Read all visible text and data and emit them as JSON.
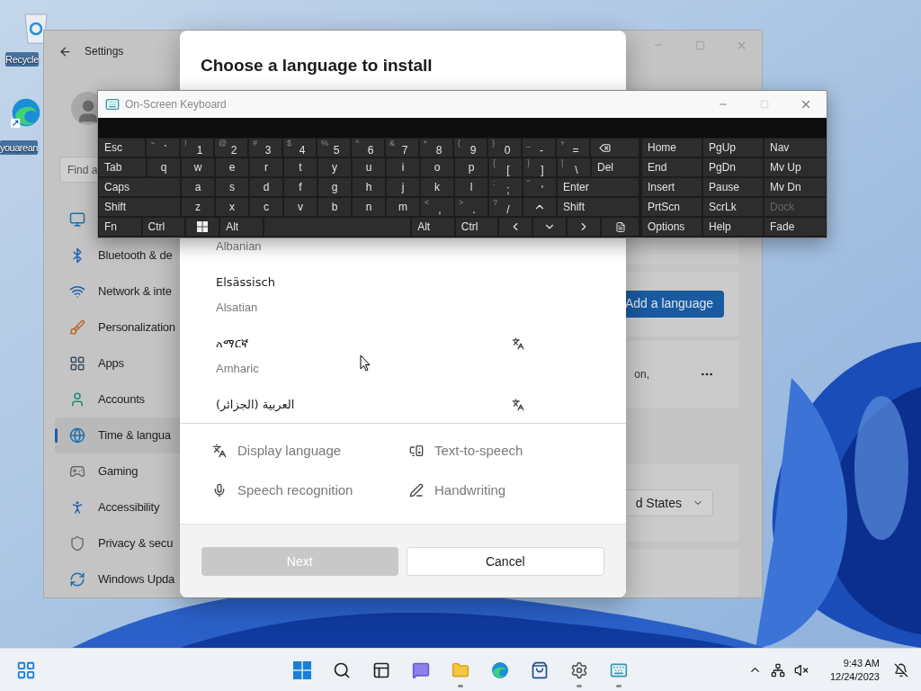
{
  "desktop": {
    "icons": [
      {
        "label": "Recycle"
      },
      {
        "label": "youarean"
      }
    ]
  },
  "settings": {
    "title": "Settings",
    "search": {
      "placeholder": "Find a"
    },
    "sidebar": {
      "items": [
        {
          "selected": false
        },
        {
          "label": "Bluetooth & de",
          "selected": false
        },
        {
          "label": "Network & inte",
          "selected": false
        },
        {
          "label": "Personalization",
          "selected": false
        },
        {
          "label": "Apps",
          "selected": false
        },
        {
          "label": "Accounts",
          "selected": false
        },
        {
          "label": "Time & langua",
          "selected": true
        },
        {
          "label": "Gaming",
          "selected": false
        },
        {
          "label": "Accessibility",
          "selected": false
        },
        {
          "label": "Privacy & secu",
          "selected": false
        },
        {
          "label": "Windows Upda",
          "selected": false
        }
      ]
    },
    "content": {
      "add_button": "Add a language",
      "card_text": "on,",
      "region_value": "d States"
    }
  },
  "dialog": {
    "title": "Choose a language to install",
    "languages": [
      {
        "english": "Albanian",
        "display_language": false
      },
      {
        "native": "Elsässisch",
        "english": "Alsatian",
        "display_language": false
      },
      {
        "native": "አማርኛ",
        "english": "Amharic",
        "display_language": true
      },
      {
        "native": "العربية (الجزائر)",
        "display_language": true
      }
    ],
    "features": [
      {
        "label": "Display language"
      },
      {
        "label": "Text-to-speech"
      },
      {
        "label": "Speech recognition"
      },
      {
        "label": "Handwriting"
      }
    ],
    "buttons": [
      {
        "label": "Next",
        "disabled": true
      },
      {
        "label": "Cancel",
        "disabled": false
      }
    ]
  },
  "keyboard": {
    "title": "On-Screen Keyboard",
    "rows": [
      {
        "keys": [
          {
            "kind": "label",
            "label": "Esc"
          },
          {
            "kind": "char",
            "shift": "~",
            "main": "`"
          },
          {
            "kind": "char",
            "shift": "!",
            "main": "1"
          },
          {
            "kind": "char",
            "shift": "@",
            "main": "2"
          },
          {
            "kind": "char",
            "shift": "#",
            "main": "3"
          },
          {
            "kind": "char",
            "shift": "$",
            "main": "4"
          },
          {
            "kind": "char",
            "shift": "%",
            "main": "5"
          },
          {
            "kind": "char",
            "shift": "^",
            "main": "6"
          },
          {
            "kind": "char",
            "shift": "&",
            "main": "7"
          },
          {
            "kind": "char",
            "shift": "*",
            "main": "8"
          },
          {
            "kind": "char",
            "shift": "(",
            "main": "9"
          },
          {
            "kind": "char",
            "shift": ")",
            "main": "0"
          },
          {
            "kind": "char",
            "shift": "_",
            "main": "-"
          },
          {
            "kind": "char",
            "shift": "+",
            "main": "="
          },
          {
            "kind": "backspace"
          }
        ]
      },
      {
        "keys": [
          {
            "kind": "label",
            "label": "Tab"
          },
          {
            "kind": "char",
            "main": "q"
          },
          {
            "kind": "char",
            "main": "w"
          },
          {
            "kind": "char",
            "main": "e"
          },
          {
            "kind": "char",
            "main": "r"
          },
          {
            "kind": "char",
            "main": "t"
          },
          {
            "kind": "char",
            "main": "y"
          },
          {
            "kind": "char",
            "main": "u"
          },
          {
            "kind": "char",
            "main": "i"
          },
          {
            "kind": "char",
            "main": "o"
          },
          {
            "kind": "char",
            "main": "p"
          },
          {
            "kind": "char",
            "shift": "{",
            "main": "["
          },
          {
            "kind": "char",
            "shift": "}",
            "main": "]"
          },
          {
            "kind": "char",
            "shift": "|",
            "main": "\\"
          },
          {
            "kind": "label",
            "label": "Del"
          }
        ]
      },
      {
        "keys": [
          {
            "kind": "label",
            "label": "Caps"
          },
          {
            "kind": "char",
            "main": "a"
          },
          {
            "kind": "char",
            "main": "s"
          },
          {
            "kind": "char",
            "main": "d"
          },
          {
            "kind": "char",
            "main": "f"
          },
          {
            "kind": "char",
            "main": "g"
          },
          {
            "kind": "char",
            "main": "h"
          },
          {
            "kind": "char",
            "main": "j"
          },
          {
            "kind": "char",
            "main": "k"
          },
          {
            "kind": "char",
            "main": "l"
          },
          {
            "kind": "char",
            "shift": ":",
            "main": ";"
          },
          {
            "kind": "char",
            "shift": "\"",
            "main": "'"
          },
          {
            "kind": "label",
            "label": "Enter"
          }
        ]
      },
      {
        "keys": [
          {
            "kind": "label",
            "label": "Shift"
          },
          {
            "kind": "char",
            "main": "z"
          },
          {
            "kind": "char",
            "main": "x"
          },
          {
            "kind": "char",
            "main": "c"
          },
          {
            "kind": "char",
            "main": "v"
          },
          {
            "kind": "char",
            "main": "b"
          },
          {
            "kind": "char",
            "main": "n"
          },
          {
            "kind": "char",
            "main": "m"
          },
          {
            "kind": "char",
            "shift": "<",
            "main": ","
          },
          {
            "kind": "char",
            "shift": ">",
            "main": "."
          },
          {
            "kind": "char",
            "shift": "?",
            "main": "/"
          },
          {
            "kind": "arrow-up"
          },
          {
            "kind": "label",
            "label": "Shift"
          }
        ]
      },
      {
        "keys": [
          {
            "kind": "label",
            "label": "Fn"
          },
          {
            "kind": "label",
            "label": "Ctrl"
          },
          {
            "kind": "windows"
          },
          {
            "kind": "label",
            "label": "Alt"
          },
          {
            "kind": "space"
          },
          {
            "kind": "label",
            "label": "Alt"
          },
          {
            "kind": "label",
            "label": "Ctrl"
          },
          {
            "kind": "arrow-left"
          },
          {
            "kind": "arrow-down"
          },
          {
            "kind": "arrow-right"
          },
          {
            "kind": "menu"
          }
        ]
      }
    ],
    "nav_keys": [
      {
        "label": "Home",
        "disabled": false
      },
      {
        "label": "PgUp",
        "disabled": false
      },
      {
        "label": "Nav",
        "disabled": false
      },
      {
        "label": "End",
        "disabled": false
      },
      {
        "label": "PgDn",
        "disabled": false
      },
      {
        "label": "Mv Up",
        "disabled": false
      },
      {
        "label": "Insert",
        "disabled": false
      },
      {
        "label": "Pause",
        "disabled": false
      },
      {
        "label": "Mv Dn",
        "disabled": false
      },
      {
        "label": "PrtScn",
        "disabled": false
      },
      {
        "label": "ScrLk",
        "disabled": false
      },
      {
        "label": "Dock",
        "disabled": true
      },
      {
        "label": "Options",
        "disabled": false
      },
      {
        "label": "Help",
        "disabled": false
      },
      {
        "label": "Fade",
        "disabled": false
      }
    ]
  },
  "taskbar": {
    "apps": [
      {
        "running": false
      },
      {
        "running": false
      },
      {
        "running": false
      },
      {
        "running": false
      },
      {
        "running": true
      },
      {
        "running": false
      },
      {
        "running": false
      },
      {
        "running": true
      },
      {
        "running": true
      }
    ],
    "time": "9:43 AM",
    "date": "12/24/2023"
  }
}
